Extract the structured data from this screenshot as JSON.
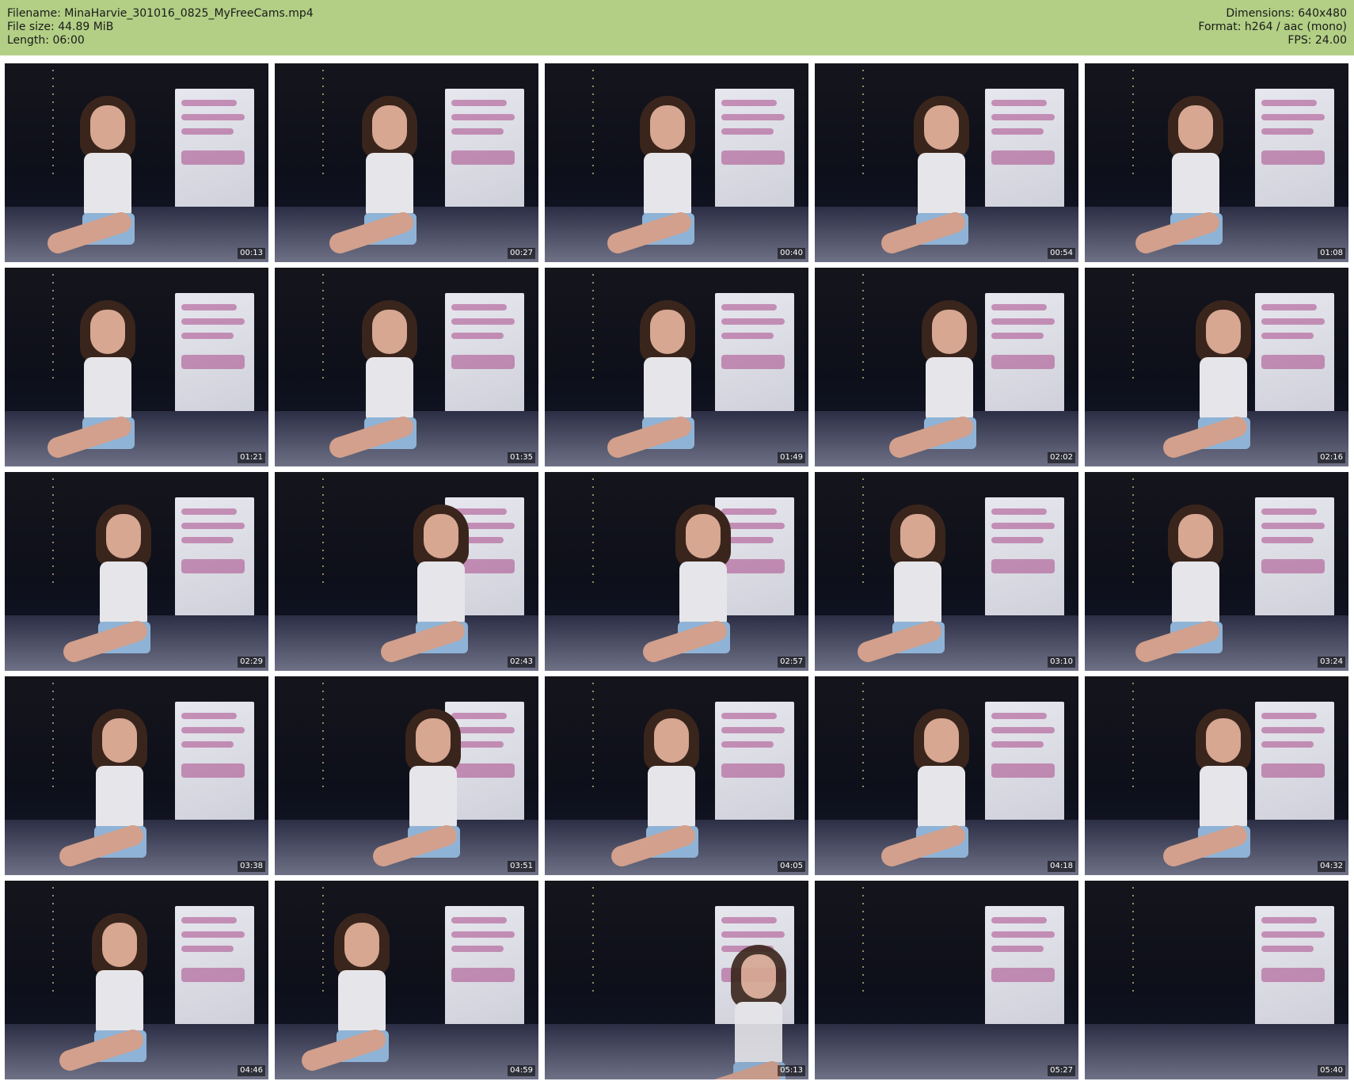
{
  "header": {
    "filename": "Filename: MinaHarvie_301016_0825_MyFreeCams.mp4",
    "filesize": "File size: 44.89 MiB",
    "length": "Length: 06:00",
    "dimensions": "Dimensions: 640x480",
    "format": "Format: h264 / aac (mono)",
    "fps": "FPS: 24.00"
  },
  "thumbnails": [
    {
      "timestamp": "00:13"
    },
    {
      "timestamp": "00:27"
    },
    {
      "timestamp": "00:40"
    },
    {
      "timestamp": "00:54"
    },
    {
      "timestamp": "01:08"
    },
    {
      "timestamp": "01:21"
    },
    {
      "timestamp": "01:35"
    },
    {
      "timestamp": "01:49"
    },
    {
      "timestamp": "02:02"
    },
    {
      "timestamp": "02:16"
    },
    {
      "timestamp": "02:29"
    },
    {
      "timestamp": "02:43"
    },
    {
      "timestamp": "02:57"
    },
    {
      "timestamp": "03:10"
    },
    {
      "timestamp": "03:24"
    },
    {
      "timestamp": "03:38"
    },
    {
      "timestamp": "03:51"
    },
    {
      "timestamp": "04:05"
    },
    {
      "timestamp": "04:18"
    },
    {
      "timestamp": "04:32"
    },
    {
      "timestamp": "04:46"
    },
    {
      "timestamp": "04:59"
    },
    {
      "timestamp": "05:13"
    },
    {
      "timestamp": "05:27"
    },
    {
      "timestamp": "05:40"
    }
  ],
  "colors": {
    "header_bg": "#b2cf85",
    "timestamp_bg": "#000000",
    "timestamp_text": "#ffffff"
  }
}
